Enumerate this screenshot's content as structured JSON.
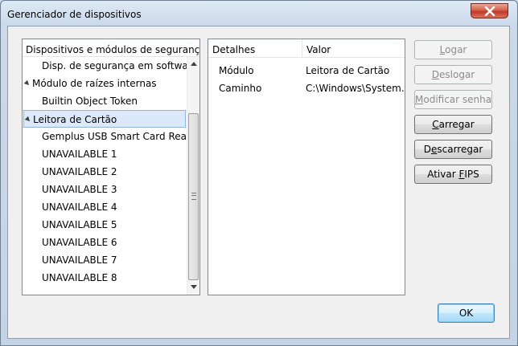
{
  "window": {
    "title": "Gerenciador de dispositivos"
  },
  "tree": {
    "header": "Dispositivos e módulos de segurança",
    "items": [
      {
        "label": "Disp. de segurança em software",
        "level": 1,
        "expandable": false,
        "selected": false
      },
      {
        "label": "Módulo de raízes internas",
        "level": 0,
        "expandable": true,
        "selected": false
      },
      {
        "label": "Builtin Object Token",
        "level": 1,
        "expandable": false,
        "selected": false
      },
      {
        "label": "Leitora de Cartão",
        "level": 0,
        "expandable": true,
        "selected": true
      },
      {
        "label": "Gemplus USB Smart Card Reade...",
        "level": 1,
        "expandable": false,
        "selected": false
      },
      {
        "label": "UNAVAILABLE 1",
        "level": 1,
        "expandable": false,
        "selected": false
      },
      {
        "label": "UNAVAILABLE 2",
        "level": 1,
        "expandable": false,
        "selected": false
      },
      {
        "label": "UNAVAILABLE 3",
        "level": 1,
        "expandable": false,
        "selected": false
      },
      {
        "label": "UNAVAILABLE 4",
        "level": 1,
        "expandable": false,
        "selected": false
      },
      {
        "label": "UNAVAILABLE 5",
        "level": 1,
        "expandable": false,
        "selected": false
      },
      {
        "label": "UNAVAILABLE 6",
        "level": 1,
        "expandable": false,
        "selected": false
      },
      {
        "label": "UNAVAILABLE 7",
        "level": 1,
        "expandable": false,
        "selected": false
      },
      {
        "label": "UNAVAILABLE 8",
        "level": 1,
        "expandable": false,
        "selected": false
      }
    ]
  },
  "details": {
    "columns": [
      "Detalhes",
      "Valor"
    ],
    "rows": [
      {
        "key": "Módulo",
        "value": "Leitora de Cartão"
      },
      {
        "key": "Caminho",
        "value": "C:\\Windows\\System..."
      }
    ]
  },
  "buttons": {
    "logar": {
      "pre": "",
      "accel": "L",
      "post": "ogar",
      "enabled": false
    },
    "deslogar": {
      "pre": "",
      "accel": "D",
      "post": "eslogar",
      "enabled": false
    },
    "modificar_senha": {
      "pre": "",
      "accel": "M",
      "post": "odificar senha",
      "enabled": false
    },
    "carregar": {
      "pre": "",
      "accel": "C",
      "post": "arregar",
      "enabled": true
    },
    "descarregar": {
      "pre": "D",
      "accel": "e",
      "post": "scarregar",
      "enabled": true
    },
    "ativar_fips": {
      "pre": "Ativar ",
      "accel": "F",
      "post": "IPS",
      "enabled": true
    },
    "ok": {
      "label": "OK"
    }
  },
  "icons": {
    "close": "close-icon",
    "expander": "expand-triangle-icon",
    "scroll_up": "scroll-up-arrow-icon",
    "scroll_down": "scroll-down-arrow-icon"
  }
}
